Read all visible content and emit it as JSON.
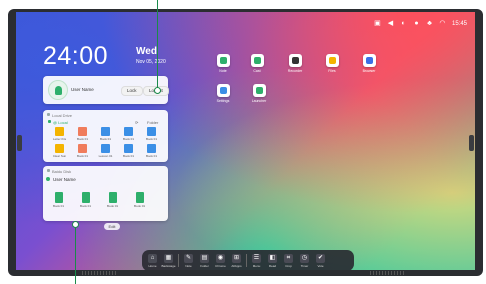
{
  "status_bar": {
    "time": "15:45",
    "icons": [
      "screenshot-icon",
      "volume-icon",
      "brightness-icon",
      "user-icon",
      "network-icon",
      "wifi-icon"
    ]
  },
  "clock": {
    "time": "24:00",
    "day": "Wed",
    "date": "Nov 05, 2020"
  },
  "user_card": {
    "username": "User Name",
    "lock_label": "Lock",
    "logout_label": "Logout"
  },
  "local_drive": {
    "title": "Local Drive",
    "sub_label": "@ Local",
    "tool_label": "Folder",
    "files": [
      {
        "name": "Letter this",
        "kind": "folder"
      },
      {
        "name": "Book 01",
        "kind": "doc"
      },
      {
        "name": "Book 01",
        "kind": "blue"
      },
      {
        "name": "Book 01",
        "kind": "blue"
      },
      {
        "name": "Book 01",
        "kind": "blue"
      },
      {
        "name": "Clear Sun",
        "kind": "folder"
      },
      {
        "name": "Book 01",
        "kind": "doc"
      },
      {
        "name": "Lesson 01",
        "kind": "blue"
      },
      {
        "name": "Book 01",
        "kind": "blue"
      },
      {
        "name": "Book 01",
        "kind": "blue"
      }
    ]
  },
  "remote_drive": {
    "title": "Baidu Disk",
    "username": "User Name",
    "files": [
      "Book 01",
      "Book 01",
      "Book 01",
      "Book 01"
    ]
  },
  "edit_label": "Edit",
  "apps": [
    {
      "label": "Note",
      "color": "#2eaf6b"
    },
    {
      "label": "Cast",
      "color": "#2eaf6b"
    },
    {
      "label": "Recorder",
      "color": "#333333"
    },
    {
      "label": "Files",
      "color": "#f4b400"
    },
    {
      "label": "Browser",
      "color": "#3b6fe6"
    },
    {
      "label": "Settings",
      "color": "#3b8fe6"
    },
    {
      "label": "Launcher",
      "color": "#2eaf6b"
    }
  ],
  "dock": [
    {
      "label": "Home",
      "icon": "home-icon"
    },
    {
      "label": "Backstage",
      "icon": "backstage-icon"
    },
    {
      "label": "Note",
      "icon": "note-icon"
    },
    {
      "label": "Folder",
      "icon": "folder-icon"
    },
    {
      "label": "Chrome",
      "icon": "chrome-icon"
    },
    {
      "label": "AllApps",
      "icon": "apps-icon"
    },
    {
      "label": "Menu",
      "icon": "menu-icon"
    },
    {
      "label": "Read",
      "icon": "read-icon"
    },
    {
      "label": "Crop",
      "icon": "crop-icon"
    },
    {
      "label": "Timer",
      "icon": "timer-icon"
    },
    {
      "label": "Vote",
      "icon": "vote-icon"
    }
  ],
  "colors": {
    "accent": "#2eaf6b",
    "bezel": "#2b2d31"
  }
}
